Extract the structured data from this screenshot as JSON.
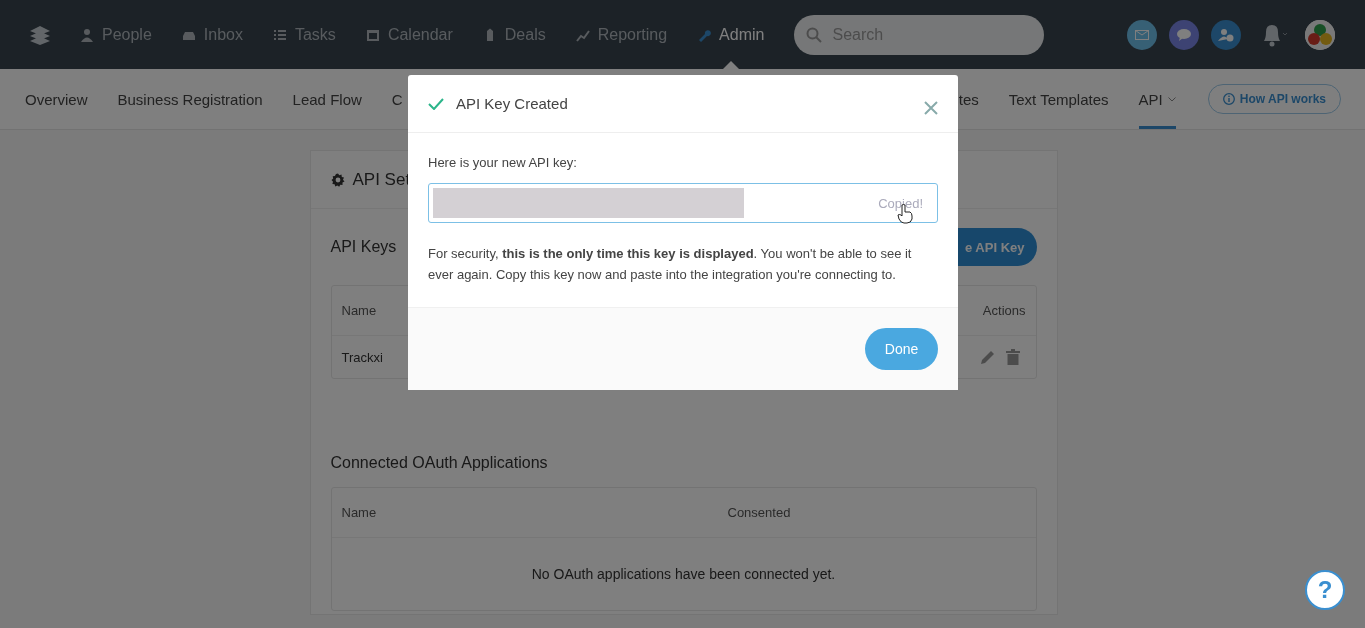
{
  "top_nav": {
    "items": [
      {
        "label": "People",
        "selected": false
      },
      {
        "label": "Inbox",
        "selected": false
      },
      {
        "label": "Tasks",
        "selected": false
      },
      {
        "label": "Calendar",
        "selected": false
      },
      {
        "label": "Deals",
        "selected": false
      },
      {
        "label": "Reporting",
        "selected": false
      },
      {
        "label": "Admin",
        "selected": true
      }
    ],
    "search": {
      "placeholder": "Search"
    }
  },
  "sub_nav": {
    "left_tabs": [
      {
        "label": "Overview",
        "selected": false
      },
      {
        "label": "Business Registration",
        "selected": false
      },
      {
        "label": "Lead Flow",
        "selected": false
      },
      {
        "label": "C",
        "selected": false
      }
    ],
    "right_tabs": [
      {
        "label": "tes",
        "selected": false,
        "kind": "plain"
      },
      {
        "label": "Text Templates",
        "selected": false,
        "kind": "plain"
      },
      {
        "label": "API",
        "selected": true,
        "kind": "dropdown"
      }
    ],
    "help_link": "How API works"
  },
  "card": {
    "title": "API Set",
    "api_keys": {
      "heading": "API Keys",
      "button": "e API Key",
      "columns": [
        "Name",
        "Actions"
      ],
      "rows": [
        {
          "name": "Trackxi"
        }
      ]
    },
    "oauth": {
      "heading": "Connected OAuth Applications",
      "columns": [
        "Name",
        "Consented"
      ],
      "empty_message": "No OAuth applications have been connected yet."
    }
  },
  "modal": {
    "title": "API Key Created",
    "label": "Here is your new API key:",
    "copy_status": "Copied!",
    "message": "For security, **this is the only time this key is displayed**. You won't be able to see it ever again. Copy this key now and paste into the integration you're connecting to.",
    "button": "Done"
  },
  "help_button": "?"
}
